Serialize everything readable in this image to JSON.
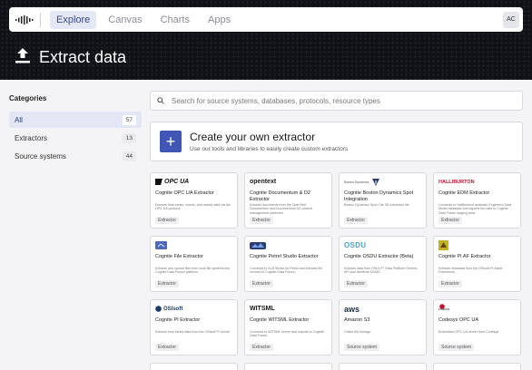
{
  "nav": {
    "items": [
      "Explore",
      "Canvas",
      "Charts",
      "Apps"
    ],
    "avatar": "AC"
  },
  "page": {
    "title": "Extract data"
  },
  "sidebar": {
    "heading": "Categories",
    "items": [
      {
        "label": "All",
        "count": "57"
      },
      {
        "label": "Extractors",
        "count": "13"
      },
      {
        "label": "Source systems",
        "count": "44"
      }
    ]
  },
  "search": {
    "placeholder": "Search for source systems, databases, protocols, resource types"
  },
  "create": {
    "title": "Create your own extractor",
    "subtitle": "Use our tools and libraries to easily create custom extractors"
  },
  "cards": [
    {
      "logo": "OPC UA",
      "title": "Cognite OPC UA Extractor",
      "desc": "Extracts time series, events, and assets data via the OPC UA protocol.",
      "tag": "Extractor"
    },
    {
      "logo": "opentext",
      "title": "Cognite Documentum & D2 Extractor",
      "desc": "Extracts documents from the OpenText Documentum and Documentum D2 content management platforms.",
      "tag": "Extractor"
    },
    {
      "logo": "Boston Dynamics",
      "title": "Cognite Boston Dynamics Spot Integration",
      "desc": "Boston Dynamics Spot Cite 3D extraction file.",
      "tag": "Extractor"
    },
    {
      "logo": "HALLIBURTON",
      "title": "Cognite EDM Extractor",
      "desc": "Connects to Halliburton/Landmark Engineers Data Model database and exports the data to Cognite Data Fusion staging area.",
      "tag": "Extractor"
    },
    {
      "logo": "",
      "title": "Cognite File Extractor",
      "desc": "Extracts and upload files from local file systems into Cognite Data Fusion platform.",
      "tag": "Extractor"
    },
    {
      "logo": "",
      "title": "Cognite Petrel Studio Extractor",
      "desc": "Connects to SLB Studio for Petrel and extracts the records to Cognite Data Fusion.",
      "tag": "Extractor"
    },
    {
      "logo": "OSDU",
      "title": "Cognite OSDU Extractor (Beta)",
      "desc": "Extracts data from OSDU™ Data Platform Generic API and Wellbore DDMS.",
      "tag": "Extractor"
    },
    {
      "logo": "",
      "title": "Cognite PI AF Extractor",
      "desc": "Extracts metadata from the OSIsoft PI Asset Framework.",
      "tag": "Extractor"
    },
    {
      "logo": "OSIsoft",
      "title": "Cognite PI Extractor",
      "desc": "Extracts time series data from the OSIsoft PI server.",
      "tag": "Extractor"
    },
    {
      "logo": "WITSML",
      "title": "Cognite WITSML Extractor",
      "desc": "Connects to WITSML server and exports to Cognite Data Fusion.",
      "tag": "Extractor"
    },
    {
      "logo": "aws",
      "title": "Amazon S3",
      "desc": "Online file storage.",
      "tag": "Source system"
    },
    {
      "logo": "CODESYS",
      "title": "Codesys OPC UA",
      "desc": "Embedded OPC UA server from Codesys.",
      "tag": "Source system"
    }
  ],
  "colors": {
    "accent": "#3f56b5",
    "hero_bg": "#101217",
    "halliburton": "#c8102e",
    "aws": "#ff9900"
  }
}
